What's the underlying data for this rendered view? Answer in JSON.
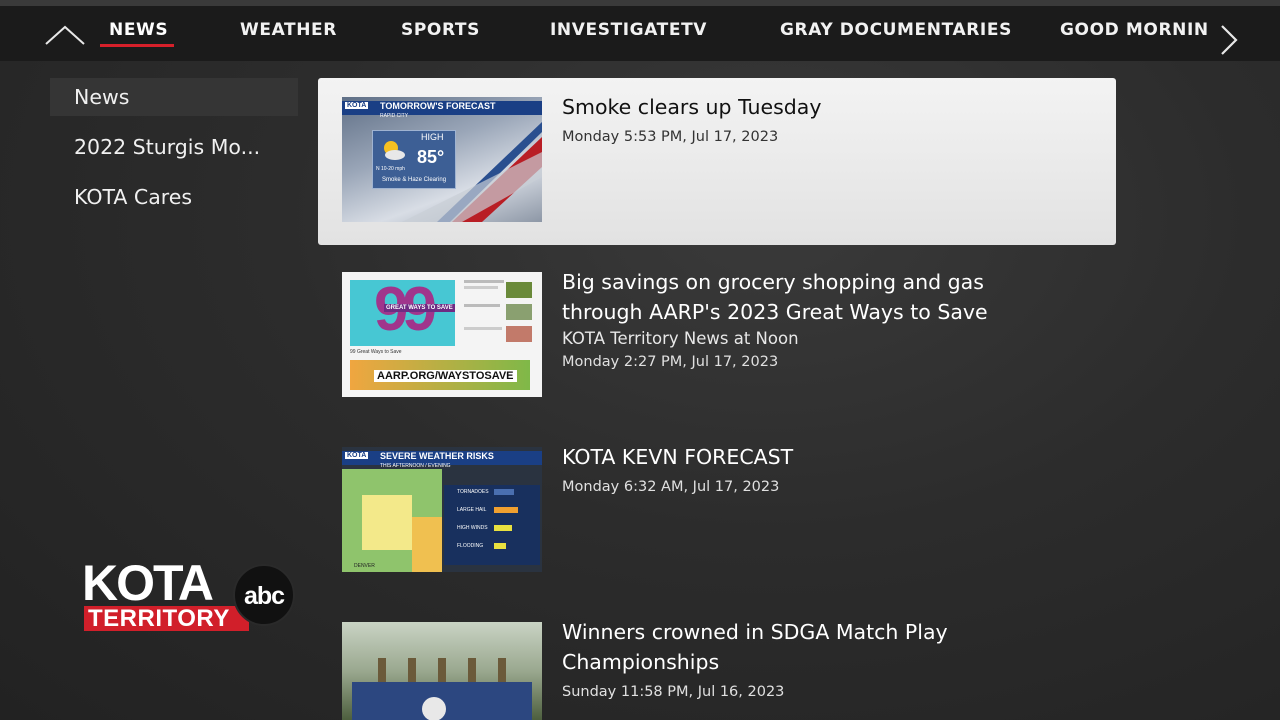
{
  "nav": {
    "items": [
      {
        "label": "NEWS",
        "active": true
      },
      {
        "label": "WEATHER",
        "active": false
      },
      {
        "label": "SPORTS",
        "active": false
      },
      {
        "label": "INVESTIGATETV",
        "active": false
      },
      {
        "label": "GRAY DOCUMENTARIES",
        "active": false
      },
      {
        "label": "GOOD MORNING",
        "active": false
      }
    ],
    "accent_color": "#d6202a",
    "up_icon": "chevron-up-icon",
    "next_icon": "chevron-right-icon"
  },
  "sidebar": {
    "items": [
      {
        "label": "News",
        "selected": true
      },
      {
        "label": "2022 Sturgis Mo..."
      },
      {
        "label": "KOTA Cares"
      }
    ]
  },
  "logo": {
    "line1": "KOTA",
    "line2": "TERRITORY",
    "network": "abc"
  },
  "videos": [
    {
      "title": "Smoke clears up Tuesday",
      "date": "Monday 5:53 PM, Jul 17, 2023",
      "thumb": {
        "badge": "KOTA",
        "header": "TOMORROW'S FORECAST",
        "location": "RAPID CITY",
        "label": "HIGH",
        "temp": "85°",
        "wind": "N 10-20 mph",
        "caption": "Smoke & Haze Clearing"
      }
    },
    {
      "title_line1": "Big savings on grocery shopping and gas",
      "title_line2": "through AARP's 2023 Great Ways to Save",
      "show": "KOTA Territory News at Noon",
      "date": "Monday 2:27 PM, Jul 17, 2023",
      "thumb": {
        "number": "99",
        "ribbon": "GREAT WAYS TO SAVE",
        "subtitle": "99 Great Ways to Save",
        "url": "AARP.ORG/WAYSTOSAVE"
      }
    },
    {
      "title": "KOTA KEVN FORECAST",
      "date": "Monday 6:32 AM, Jul 17, 2023",
      "thumb": {
        "badge": "KOTA",
        "header": "SEVERE WEATHER RISKS",
        "subheader": "THIS AFTERNOON / EVENING",
        "risks": [
          "TORNADOES",
          "LARGE HAIL",
          "HIGH WINDS",
          "FLOODING"
        ],
        "city": "DENVER"
      }
    },
    {
      "title_line1": "Winners crowned in SDGA Match Play",
      "title_line2": "Championships",
      "date": "Sunday 11:58 PM, Jul 16, 2023"
    }
  ]
}
